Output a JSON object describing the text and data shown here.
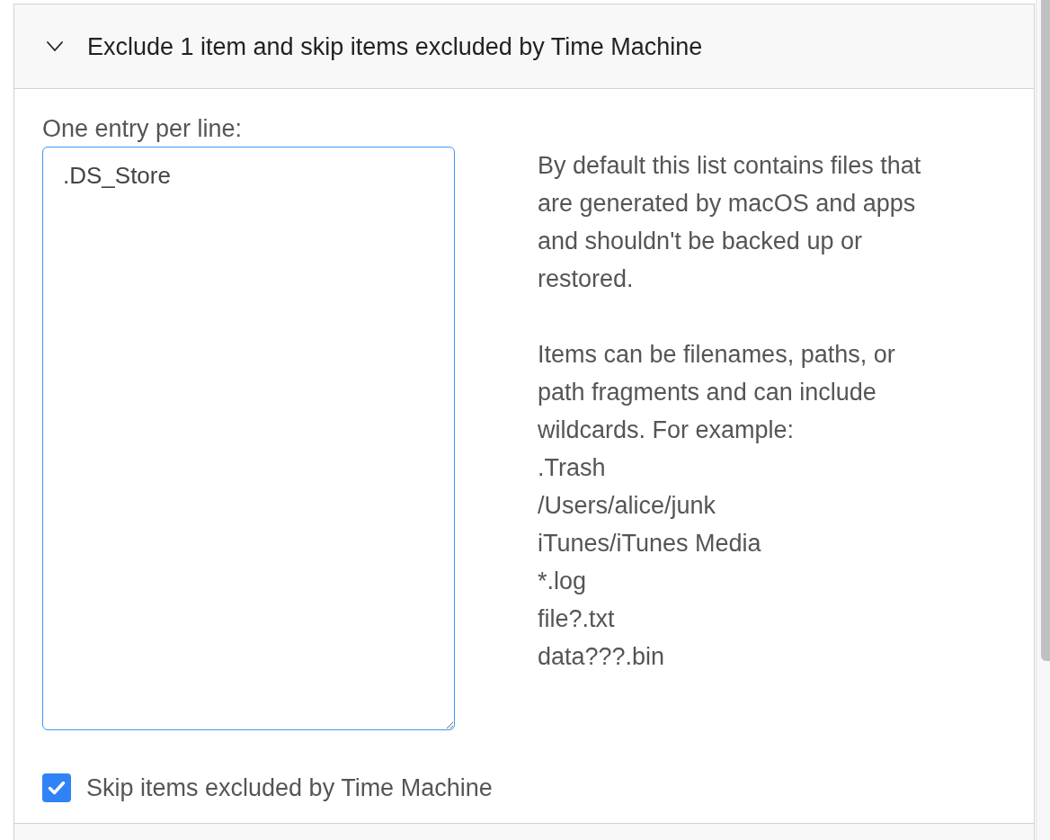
{
  "section": {
    "title": "Exclude 1 item and skip items excluded by Time Machine",
    "expanded": true
  },
  "exclude_list": {
    "label": "One entry per line:",
    "entries": [
      ".DS_Store"
    ]
  },
  "help": {
    "paragraphs": [
      "By default this list contains files that are generated by macOS and apps and shouldn't be backed up or restored.",
      "Items can be filenames, paths, or path fragments and can include wildcards. For example:"
    ],
    "examples": [
      ".Trash",
      "/Users/alice/junk",
      "iTunes/iTunes Media",
      "*.log",
      "file?.txt",
      "data???.bin"
    ]
  },
  "skip_option": {
    "label": "Skip items excluded by Time Machine",
    "checked": true
  }
}
